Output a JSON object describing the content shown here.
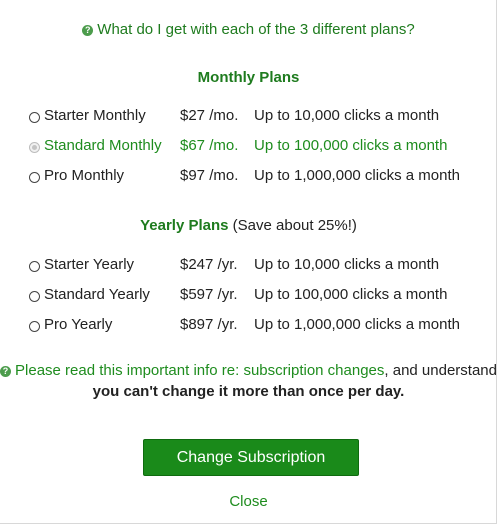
{
  "question": {
    "icon": "question-circle-icon",
    "text": "What do I get with each of the 3 different plans?"
  },
  "monthly": {
    "heading": "Monthly Plans",
    "plans": [
      {
        "name": "Starter Monthly",
        "price": "$27 /mo.",
        "desc": "Up to 10,000 clicks a month",
        "current": false
      },
      {
        "name": "Standard Monthly",
        "price": "$67 /mo.",
        "desc": "Up to 100,000 clicks a month",
        "current": true
      },
      {
        "name": "Pro Monthly",
        "price": "$97 /mo.",
        "desc": "Up to 1,000,000 clicks a month",
        "current": false
      }
    ]
  },
  "yearly": {
    "heading": "Yearly Plans",
    "note": "(Save about 25%!)",
    "plans": [
      {
        "name": "Starter Yearly",
        "price": "$247 /yr.",
        "desc": "Up to 10,000 clicks a month",
        "current": false
      },
      {
        "name": "Standard Yearly",
        "price": "$597 /yr.",
        "desc": "Up to 100,000 clicks a month",
        "current": false
      },
      {
        "name": "Pro Yearly",
        "price": "$897 /yr.",
        "desc": "Up to 1,000,000 clicks a month",
        "current": false
      }
    ]
  },
  "info": {
    "icon": "question-circle-icon",
    "link_text": "Please read this important info re: subscription changes",
    "middle": ", and understand ",
    "bold": "you can't change it more than once per day."
  },
  "actions": {
    "change_label": "Change Subscription",
    "close_label": "Close"
  },
  "colors": {
    "accent_green": "#1e8c1e",
    "button_green": "#1a8a1a"
  }
}
